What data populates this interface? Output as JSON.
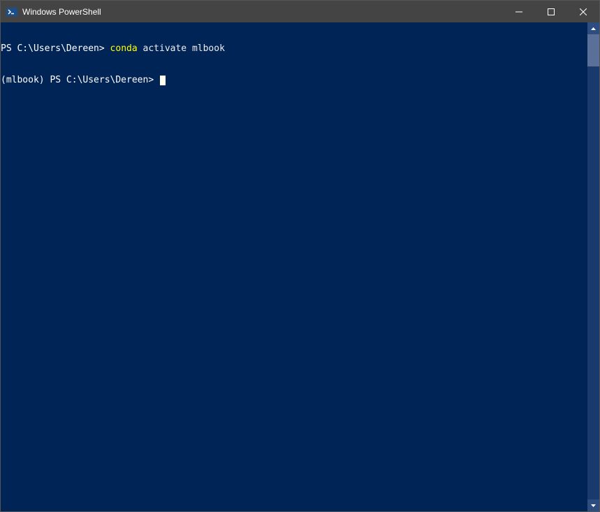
{
  "window": {
    "title": "Windows PowerShell"
  },
  "terminal": {
    "lines": [
      {
        "prompt": "PS C:\\Users\\Dereen>",
        "command_highlighted": "conda",
        "command_rest": " activate mlbook"
      },
      {
        "prompt": "(mlbook) PS C:\\Users\\Dereen>",
        "command_highlighted": "",
        "command_rest": ""
      }
    ]
  }
}
